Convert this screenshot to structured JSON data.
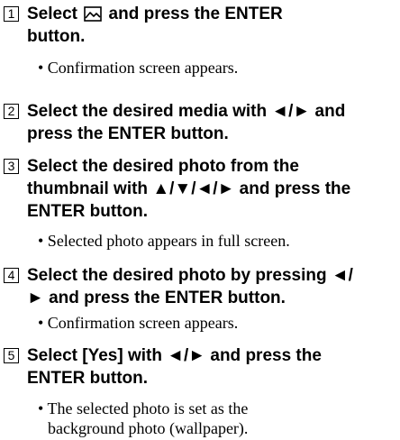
{
  "steps": [
    {
      "number": "1",
      "title_before_icon": "Select ",
      "icon": "picture-icon",
      "title_after_icon": " and press the ENTER",
      "title_line2": "button.",
      "notes": [
        "• Confirmation screen appears."
      ]
    },
    {
      "number": "2",
      "title_line1": "Select the desired media with ◄/► and",
      "title_line2": "press the ENTER button.",
      "notes": []
    },
    {
      "number": "3",
      "title_line1": "Select the desired photo from the",
      "title_line2": "thumbnail with ▲/▼/◄/► and press the",
      "title_line3": "ENTER button.",
      "notes": [
        "• Selected photo appears in full screen."
      ]
    },
    {
      "number": "4",
      "title_line1": "Select the desired photo by pressing ◄/",
      "title_line2": "► and press the ENTER button.",
      "notes": [
        "• Confirmation screen appears."
      ]
    },
    {
      "number": "5",
      "title_line1": "Select [Yes] with ◄/► and press the",
      "title_line2": "ENTER button.",
      "notes": [
        "• The selected photo is set as the",
        "background photo (wallpaper)."
      ]
    }
  ]
}
